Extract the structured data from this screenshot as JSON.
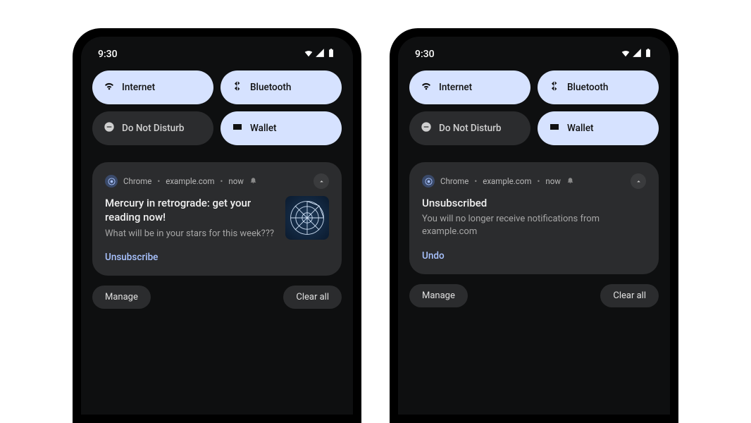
{
  "status": {
    "time": "9:30"
  },
  "tiles": {
    "internet": "Internet",
    "bluetooth": "Bluetooth",
    "dnd": "Do Not Disturb",
    "wallet": "Wallet"
  },
  "notif_header": {
    "app": "Chrome",
    "origin": "example.com",
    "time": "now"
  },
  "left_notif": {
    "title": "Mercury in retrograde: get your reading now!",
    "body": "What will be in your stars for this week???",
    "action": "Unsubscribe"
  },
  "right_notif": {
    "title": "Unsubscribed",
    "body": "You will no longer receive notifications from example.com",
    "action": "Undo"
  },
  "shade": {
    "manage": "Manage",
    "clear_all": "Clear all"
  }
}
